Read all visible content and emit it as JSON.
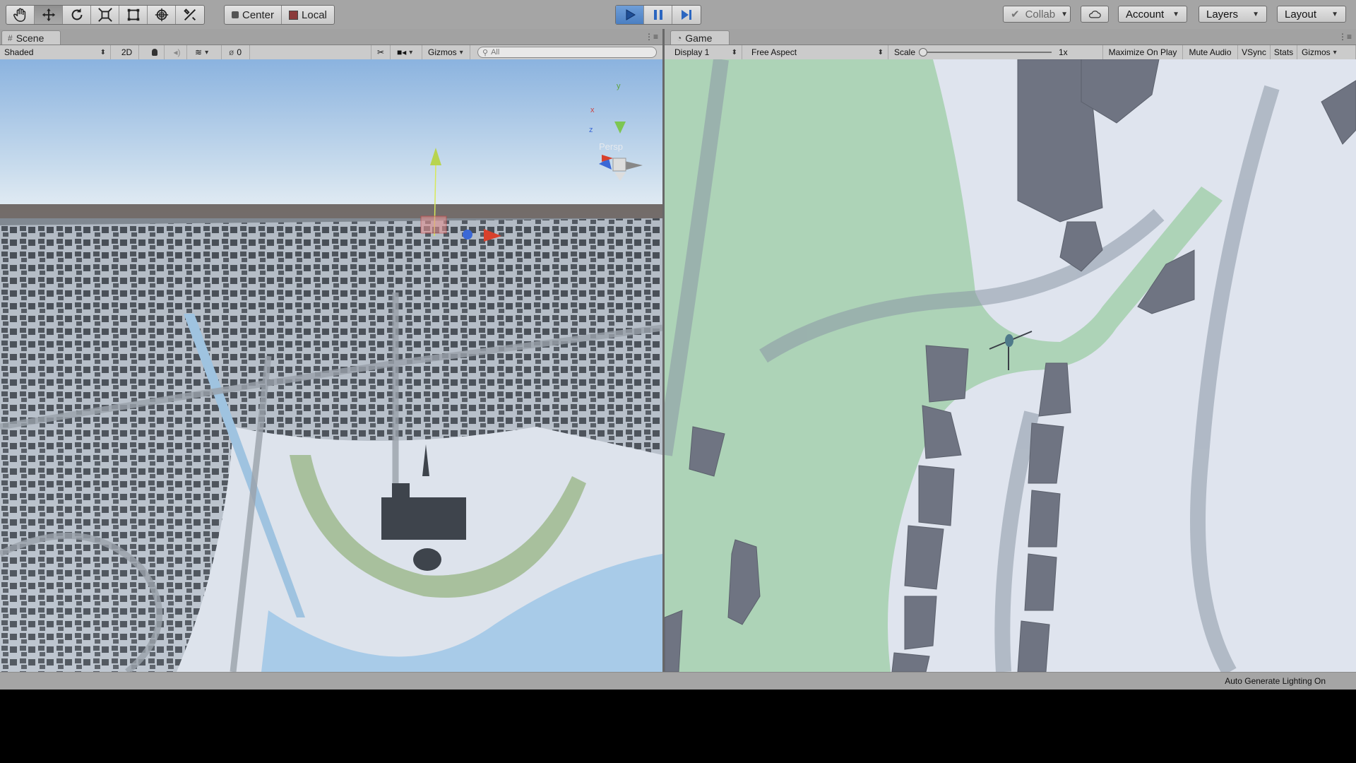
{
  "toolbar": {
    "tools": [
      {
        "name": "hand-tool",
        "icon": "hand-icon"
      },
      {
        "name": "move-tool",
        "icon": "move-arrows-icon"
      },
      {
        "name": "rotate-tool",
        "icon": "rotate-icon"
      },
      {
        "name": "scale-tool",
        "icon": "scale-icon"
      },
      {
        "name": "rect-tool",
        "icon": "rect-icon"
      },
      {
        "name": "transform-tool",
        "icon": "transform-icon"
      },
      {
        "name": "custom-tool",
        "icon": "tools-icon"
      }
    ],
    "pivot_label": "Center",
    "space_label": "Local",
    "collab_label": "Collab",
    "account_label": "Account",
    "layers_label": "Layers",
    "layout_label": "Layout"
  },
  "scene": {
    "tab_label": "Scene",
    "shading_mode": "Shaded",
    "mode_2d_label": "2D",
    "hidden_count": "0",
    "gizmos_label": "Gizmos",
    "search_placeholder": "All",
    "persp_label": "Persp",
    "axis_labels": {
      "y": "y",
      "x": "x",
      "z": "z"
    }
  },
  "game": {
    "tab_label": "Game",
    "display": "Display 1",
    "aspect": "Free Aspect",
    "scale_label": "Scale",
    "scale_value": "1x",
    "buttons": [
      "Maximize On Play",
      "Mute Audio",
      "VSync",
      "Stats",
      "Gizmos"
    ]
  },
  "status": {
    "lighting_text": "Auto Generate Lighting On"
  },
  "colors": {
    "editor_gray": "#a5a5a5",
    "play_active": "#4b7fc2",
    "sky_top": "#8fb6e0",
    "building": "#4a5058",
    "snow": "#dde3ec",
    "park_green": "#9fcba9",
    "water": "#a8cbe8"
  }
}
